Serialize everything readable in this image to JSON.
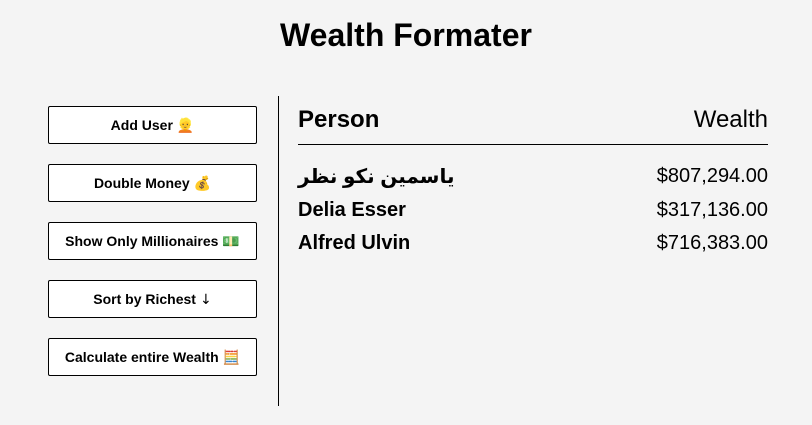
{
  "header": {
    "title": "Wealth Formater"
  },
  "sidebar": {
    "buttons": [
      {
        "label": "Add User",
        "emoji": "👱"
      },
      {
        "label": "Double Money",
        "emoji": "💰"
      },
      {
        "label": "Show Only Millionaires",
        "emoji": "💵"
      },
      {
        "label": "Sort by Richest",
        "emoji": "↓"
      },
      {
        "label": "Calculate entire Wealth",
        "emoji": "🧮"
      }
    ]
  },
  "table": {
    "headers": {
      "person": "Person",
      "wealth": "Wealth"
    },
    "rows": [
      {
        "person": "ياسمين نكو نظر",
        "wealth": "$807,294.00"
      },
      {
        "person": "Delia Esser",
        "wealth": "$317,136.00"
      },
      {
        "person": "Alfred Ulvin",
        "wealth": "$716,383.00"
      }
    ]
  }
}
